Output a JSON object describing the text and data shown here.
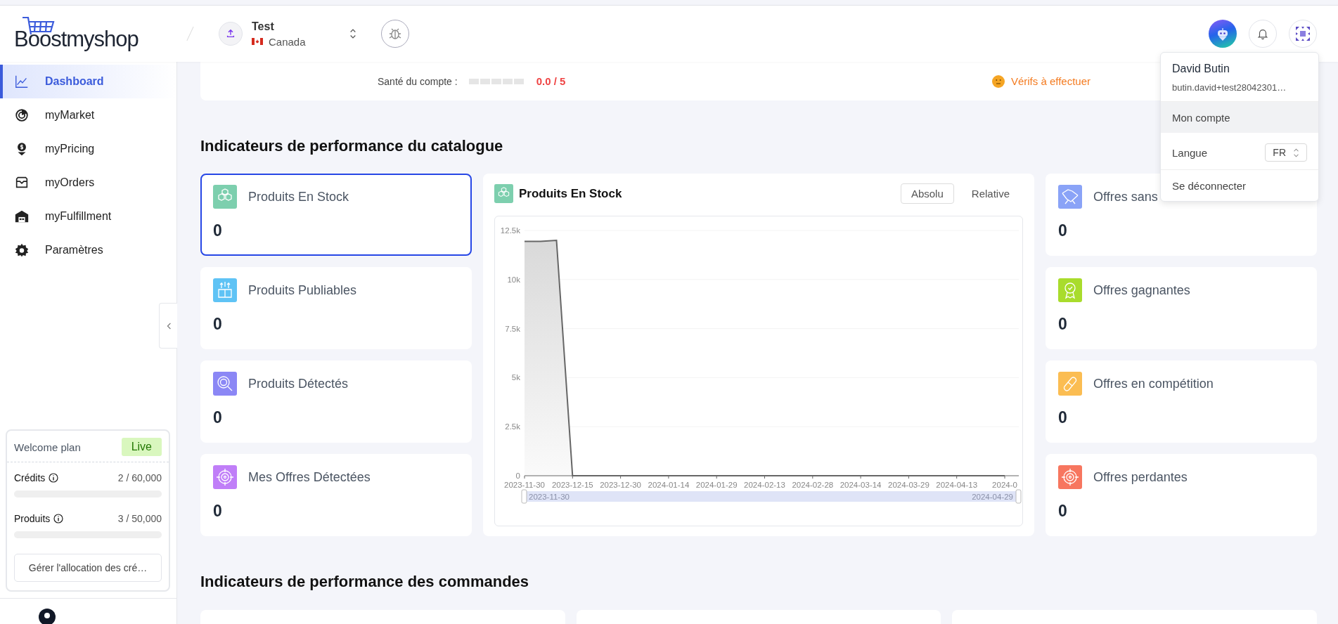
{
  "header": {
    "logo": "Boostmyshop",
    "store": {
      "name": "Test",
      "country": "Canada"
    }
  },
  "account_health": {
    "label": "Santé du compte :",
    "level": 0,
    "score": "0.0 / 5",
    "checks": "Vérifs à effectuer"
  },
  "sidebar": {
    "items": [
      {
        "kind": "chart",
        "label": "Dashboard",
        "selected": true
      },
      {
        "kind": "market",
        "label": "myMarket",
        "selected": false
      },
      {
        "kind": "pricing",
        "label": "myPricing",
        "selected": false
      },
      {
        "kind": "orders",
        "label": "myOrders",
        "selected": false
      },
      {
        "kind": "warehouse",
        "label": "myFulfillment",
        "selected": false
      },
      {
        "kind": "settings",
        "label": "Paramètres",
        "selected": false
      }
    ],
    "plan": {
      "name": "Welcome plan",
      "status": "Live",
      "quotas": [
        {
          "label": "Crédits",
          "reading": "2 / 60,000",
          "level": 3e-05
        },
        {
          "label": "Produits",
          "reading": "3 / 50,000",
          "level": 6e-05
        }
      ],
      "button": "Gérer l'allocation des cré…"
    }
  },
  "user_menu": {
    "name": "David Butin",
    "email": "butin.david+test28042301…",
    "items": [
      {
        "kind": "link",
        "label": "Mon compte",
        "selected": true
      },
      {
        "kind": "select",
        "label": "Langue",
        "value": "FR",
        "selected": false
      },
      {
        "kind": "link",
        "label": "Se déconnecter",
        "selected": false
      }
    ]
  },
  "catalog": {
    "title": "Indicateurs de performance du catalogue",
    "left_cards": [
      {
        "kind": "boxes",
        "title": "Produits En Stock",
        "value": "0",
        "color": "#7dcfae",
        "selected": true
      },
      {
        "kind": "box-arrows",
        "title": "Produits Publiables",
        "value": "0",
        "color": "#5fc3f5",
        "selected": false
      },
      {
        "kind": "search",
        "title": "Produits Détectés",
        "value": "0",
        "color": "#8b87f5",
        "selected": false
      },
      {
        "kind": "target",
        "title": "Mes Offres Détectées",
        "value": "0",
        "color": "#c07ef8",
        "selected": false
      }
    ],
    "chart_panel": {
      "title": "Produits En Stock",
      "modes": [
        {
          "label": "Absolu",
          "selected": true
        },
        {
          "label": "Relative",
          "selected": false
        }
      ],
      "range_start": "2023-11-30",
      "range_end": "2024-04-29",
      "chart_data": {
        "type": "area",
        "categories": [
          "2023-11-30",
          null,
          null,
          "2023-12-15",
          null,
          null,
          "2023-12-30",
          null,
          null,
          "2024-01-14",
          null,
          null,
          "2024-01-29",
          null,
          null,
          "2024-02-13",
          null,
          null,
          "2024-02-28",
          null,
          null,
          "2024-03-14",
          null,
          null,
          "2024-03-29",
          null,
          null,
          "2024-04-13",
          null,
          null,
          "2024-0"
        ],
        "series": [
          {
            "color": "#666666",
            "values": [
              11950,
              11950,
              12000,
              0,
              0,
              0,
              0,
              0,
              0,
              0,
              0,
              0,
              0,
              0,
              0,
              0,
              0,
              0,
              0,
              0,
              0,
              0,
              0,
              0,
              0,
              0,
              0,
              0,
              0,
              0,
              0
            ]
          }
        ],
        "ylim": [
          0,
          12500
        ],
        "grid": true,
        "yticks": [
          {
            "value": 0,
            "label": "0"
          },
          {
            "value": 2500,
            "label": "2.5k"
          },
          {
            "value": 5000,
            "label": "5k"
          },
          {
            "value": 7500,
            "label": "7.5k"
          },
          {
            "value": 10000,
            "label": "10k"
          },
          {
            "value": 12500,
            "label": "12.5k"
          }
        ]
      }
    },
    "right_cards": [
      {
        "kind": "handshake",
        "title": "Offres sans",
        "value": "0",
        "color": "#8aa3f7",
        "selected": false
      },
      {
        "kind": "award",
        "title": "Offres gagnantes",
        "value": "0",
        "color": "#a9dc2c",
        "selected": false
      },
      {
        "kind": "pills",
        "title": "Offres en compétition",
        "value": "0",
        "color": "#fbbd52",
        "selected": false
      },
      {
        "kind": "lost",
        "title": "Offres perdantes",
        "value": "0",
        "color": "#f7765f",
        "selected": false
      }
    ]
  },
  "orders": {
    "title": "Indicateurs de performance des commandes"
  }
}
